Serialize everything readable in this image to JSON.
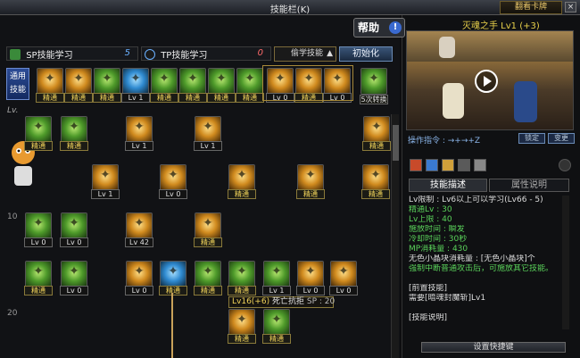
{
  "window": {
    "title": "技能栏(K)",
    "corner_button": "翻看卡牌",
    "close": "×"
  },
  "mini_tabs": [
    "+",
    "+"
  ],
  "sp_section": {
    "label": "SP技能学习",
    "points": "5"
  },
  "tp_section": {
    "label": "TP技能学习",
    "points": "0"
  },
  "filter": {
    "label": "偷学技能"
  },
  "init_button": "初始化",
  "quick_label": "通用技能",
  "quick_bar": [
    {
      "badge": "精通"
    },
    {
      "badge": "精通"
    },
    {
      "badge": "精通"
    },
    {
      "badge": "Lv 1"
    },
    {
      "badge": "精通"
    },
    {
      "badge": "精通"
    },
    {
      "badge": "精通"
    },
    {
      "badge": "精通"
    },
    {
      "badge": "Lv 0"
    },
    {
      "badge": "精通"
    },
    {
      "badge": "Lv 0"
    }
  ],
  "quick_extra": {
    "label": "5次转换"
  },
  "level_header": "Lv.",
  "row_labels": [
    "10",
    "20"
  ],
  "tree_row1": [
    {
      "badge": "精通"
    },
    {
      "badge": "精通"
    },
    {
      "badge": "Lv 1"
    },
    {
      "badge": "Lv 1"
    },
    {
      "badge": "精通"
    }
  ],
  "tree_row2": [
    {
      "badge": "Lv 1"
    },
    {
      "badge": "Lv 0"
    },
    {
      "badge": "精通"
    },
    {
      "badge": "精通"
    },
    {
      "badge": "精通"
    }
  ],
  "tree_row3": [
    {
      "badge": "Lv 0"
    },
    {
      "badge": "Lv 0"
    },
    {
      "badge": "Lv 42"
    },
    {
      "badge": "精通"
    }
  ],
  "tree_row4": [
    {
      "badge": "精通"
    },
    {
      "badge": "Lv 0"
    },
    {
      "badge": "Lv 0"
    },
    {
      "badge": "精通"
    },
    {
      "badge": "精通"
    },
    {
      "badge": "精通"
    },
    {
      "badge": "Lv 1"
    },
    {
      "badge": "Lv 0"
    },
    {
      "badge": "Lv 0"
    }
  ],
  "tree_row5": [
    {
      "badge": "精通"
    },
    {
      "badge": "精通"
    }
  ],
  "tooltip": {
    "level": "Lv16(+6)",
    "name": "死亡抗拒",
    "sp": "SP : 20"
  },
  "help": {
    "label": "帮助",
    "q": "!"
  },
  "preview": {
    "title": "灭魂之手 Lv1 (+3)",
    "command_label": "操作指令 : →+→+Z",
    "lock_btn": "锁定",
    "change_btn": "变更"
  },
  "right_tabs": [
    "技能描述",
    "属性说明"
  ],
  "description": {
    "l1": "Lv限制 : Lv6以上可以学习(Lv66 - 5)",
    "l2": "精通Lv : 30",
    "l3": "Lv上限 : 40",
    "l4": "施放时间 : 瞬发",
    "l5": "冷却时间 : 30秒",
    "l6": "MP消耗量 : 430",
    "l7": "无色小晶块消耗量 : [无色小晶块]个",
    "l8": "强制中断普通攻击后，可施放其它技能。",
    "l9": "[前置技能]",
    "l10": "需要[暗魂封魔斩]Lv1",
    "l11": "[技能说明]"
  },
  "keybind_button": "设置快捷键",
  "colors": {
    "gold": "#f2d45a",
    "green": "#5ad25a",
    "blue": "#6aa8ff"
  }
}
